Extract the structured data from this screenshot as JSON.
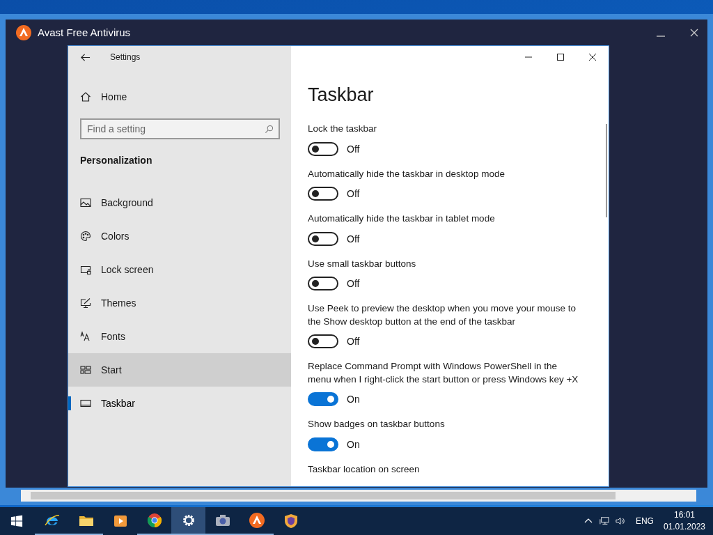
{
  "app_window": {
    "title": "Avast Free Antivirus"
  },
  "settings_window": {
    "title": "Settings",
    "home": "Home",
    "search": {
      "placeholder": "Find a setting"
    },
    "section": "Personalization",
    "nav_items": [
      {
        "label": "Background",
        "kind": "background",
        "selected": false,
        "hovered": false
      },
      {
        "label": "Colors",
        "kind": "colors",
        "selected": false,
        "hovered": false
      },
      {
        "label": "Lock screen",
        "kind": "lock",
        "selected": false,
        "hovered": false
      },
      {
        "label": "Themes",
        "kind": "themes",
        "selected": false,
        "hovered": false
      },
      {
        "label": "Fonts",
        "kind": "fonts",
        "selected": false,
        "hovered": false
      },
      {
        "label": "Start",
        "kind": "start",
        "selected": false,
        "hovered": true
      },
      {
        "label": "Taskbar",
        "kind": "taskbar",
        "selected": true,
        "hovered": false
      }
    ],
    "page_title": "Taskbar",
    "settings": [
      {
        "label": "Lock the taskbar",
        "on": false,
        "state": "Off"
      },
      {
        "label": "Automatically hide the taskbar in desktop mode",
        "on": false,
        "state": "Off"
      },
      {
        "label": "Automatically hide the taskbar in tablet mode",
        "on": false,
        "state": "Off"
      },
      {
        "label": "Use small taskbar buttons",
        "on": false,
        "state": "Off"
      },
      {
        "label": "Use Peek to preview the desktop when you move your mouse to the Show desktop button at the end of the taskbar",
        "on": false,
        "state": "Off"
      },
      {
        "label": "Replace Command Prompt with Windows PowerShell in the menu when I right-click the start button or press Windows key +X",
        "on": true,
        "state": "On"
      },
      {
        "label": "Show badges on taskbar buttons",
        "on": true,
        "state": "On"
      }
    ],
    "next_heading": "Taskbar location on screen"
  },
  "taskbar": {
    "apps": [
      {
        "kind": "ie",
        "running": true,
        "active": false
      },
      {
        "kind": "folder",
        "running": true,
        "active": false
      },
      {
        "kind": "media",
        "running": false,
        "active": false
      },
      {
        "kind": "chrome",
        "running": true,
        "active": false
      },
      {
        "kind": "settings",
        "running": true,
        "active": true
      },
      {
        "kind": "camera",
        "running": true,
        "active": false
      },
      {
        "kind": "avast",
        "running": true,
        "active": false
      },
      {
        "kind": "shield",
        "running": false,
        "active": false
      }
    ],
    "language": "ENG",
    "time": "16:01",
    "date": "01.01.2023"
  }
}
